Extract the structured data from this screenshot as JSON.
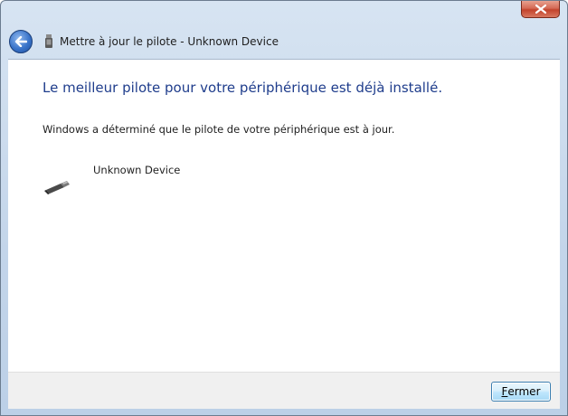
{
  "window": {
    "title": "Mettre à jour le pilote - Unknown Device",
    "close_icon": "close-x-icon",
    "back_icon": "back-arrow-icon",
    "nav_icon": "usb-device-icon",
    "accent_close": "#c3432c",
    "accent_back": "#3a74c9"
  },
  "content": {
    "heading": "Le meilleur pilote pour votre périphérique est déjà installé.",
    "message": "Windows a déterminé que le pilote de votre périphérique est à jour.",
    "device_name": "Unknown Device",
    "device_icon": "usb-plug-icon",
    "heading_color": "#1f3d8c"
  },
  "footer": {
    "close_button_mnemonic": "F",
    "close_button_rest": "ermer"
  }
}
